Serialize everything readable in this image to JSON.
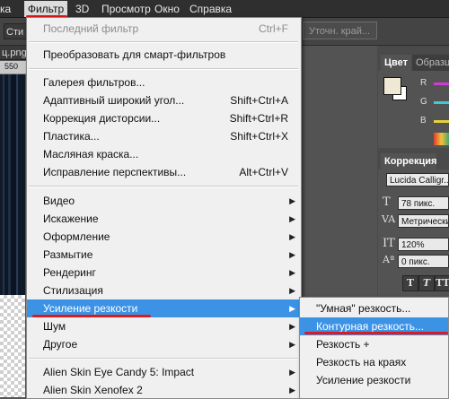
{
  "menubar": {
    "edge": "ка",
    "filter": "Фильтр",
    "three_d": "3D",
    "view": "Просмотр",
    "window": "Окно",
    "help": "Справка"
  },
  "options_bar": {
    "left_label": "Сти",
    "refine_button": "Уточн. край..."
  },
  "document": {
    "tab_label": "ц.png",
    "ruler_number": "550"
  },
  "filter_menu": {
    "last_filter": {
      "label": "Последний фильтр",
      "shortcut": "Ctrl+F"
    },
    "convert_smart": {
      "label": "Преобразовать для смарт-фильтров"
    },
    "gallery": {
      "label": "Галерея фильтров..."
    },
    "adaptive_wide": {
      "label": "Адаптивный широкий угол...",
      "shortcut": "Shift+Ctrl+A"
    },
    "lens_correction": {
      "label": "Коррекция дисторсии...",
      "shortcut": "Shift+Ctrl+R"
    },
    "liquify": {
      "label": "Пластика...",
      "shortcut": "Shift+Ctrl+X"
    },
    "oil_paint": {
      "label": "Масляная краска..."
    },
    "vanishing_point": {
      "label": "Исправление перспективы...",
      "shortcut": "Alt+Ctrl+V"
    },
    "video": {
      "label": "Видео"
    },
    "distort": {
      "label": "Искажение"
    },
    "render_design": {
      "label": "Оформление"
    },
    "blur": {
      "label": "Размытие"
    },
    "render": {
      "label": "Рендеринг"
    },
    "stylize": {
      "label": "Стилизация"
    },
    "sharpen": {
      "label": "Усиление резкости"
    },
    "noise": {
      "label": "Шум"
    },
    "other": {
      "label": "Другое"
    },
    "eye_candy": {
      "label": "Alien Skin Eye Candy 5: Impact"
    },
    "xenofex": {
      "label": "Alien Skin Xenofex 2"
    }
  },
  "sharpen_submenu": {
    "smart_sharpen": "\"Умная\" резкость...",
    "unsharp_mask": "Контурная резкость...",
    "sharpen_more": "Резкость +",
    "sharpen_edges": "Резкость на краях",
    "sharpen": "Усиление резкости"
  },
  "panels": {
    "color_tab": "Цвет",
    "swatches_tab": "Образцы",
    "channel_r": "R",
    "channel_g": "G",
    "channel_b": "B",
    "correction_tab": "Коррекция",
    "font_family": "Lucida Calligr...",
    "font_size": "78 пикс.",
    "tracking": "Метрический",
    "vertical_scale": "120%",
    "baseline_shift": "0 пикс.",
    "t_regular": "T",
    "t_italic": "T",
    "t_caps": "TT"
  },
  "colors": {
    "highlight": "#3c93e6",
    "annotation_red": "#d91c1c",
    "r_bar": "#d23bd2",
    "g_bar": "#3fcad4",
    "b_bar": "#e6d13a"
  }
}
